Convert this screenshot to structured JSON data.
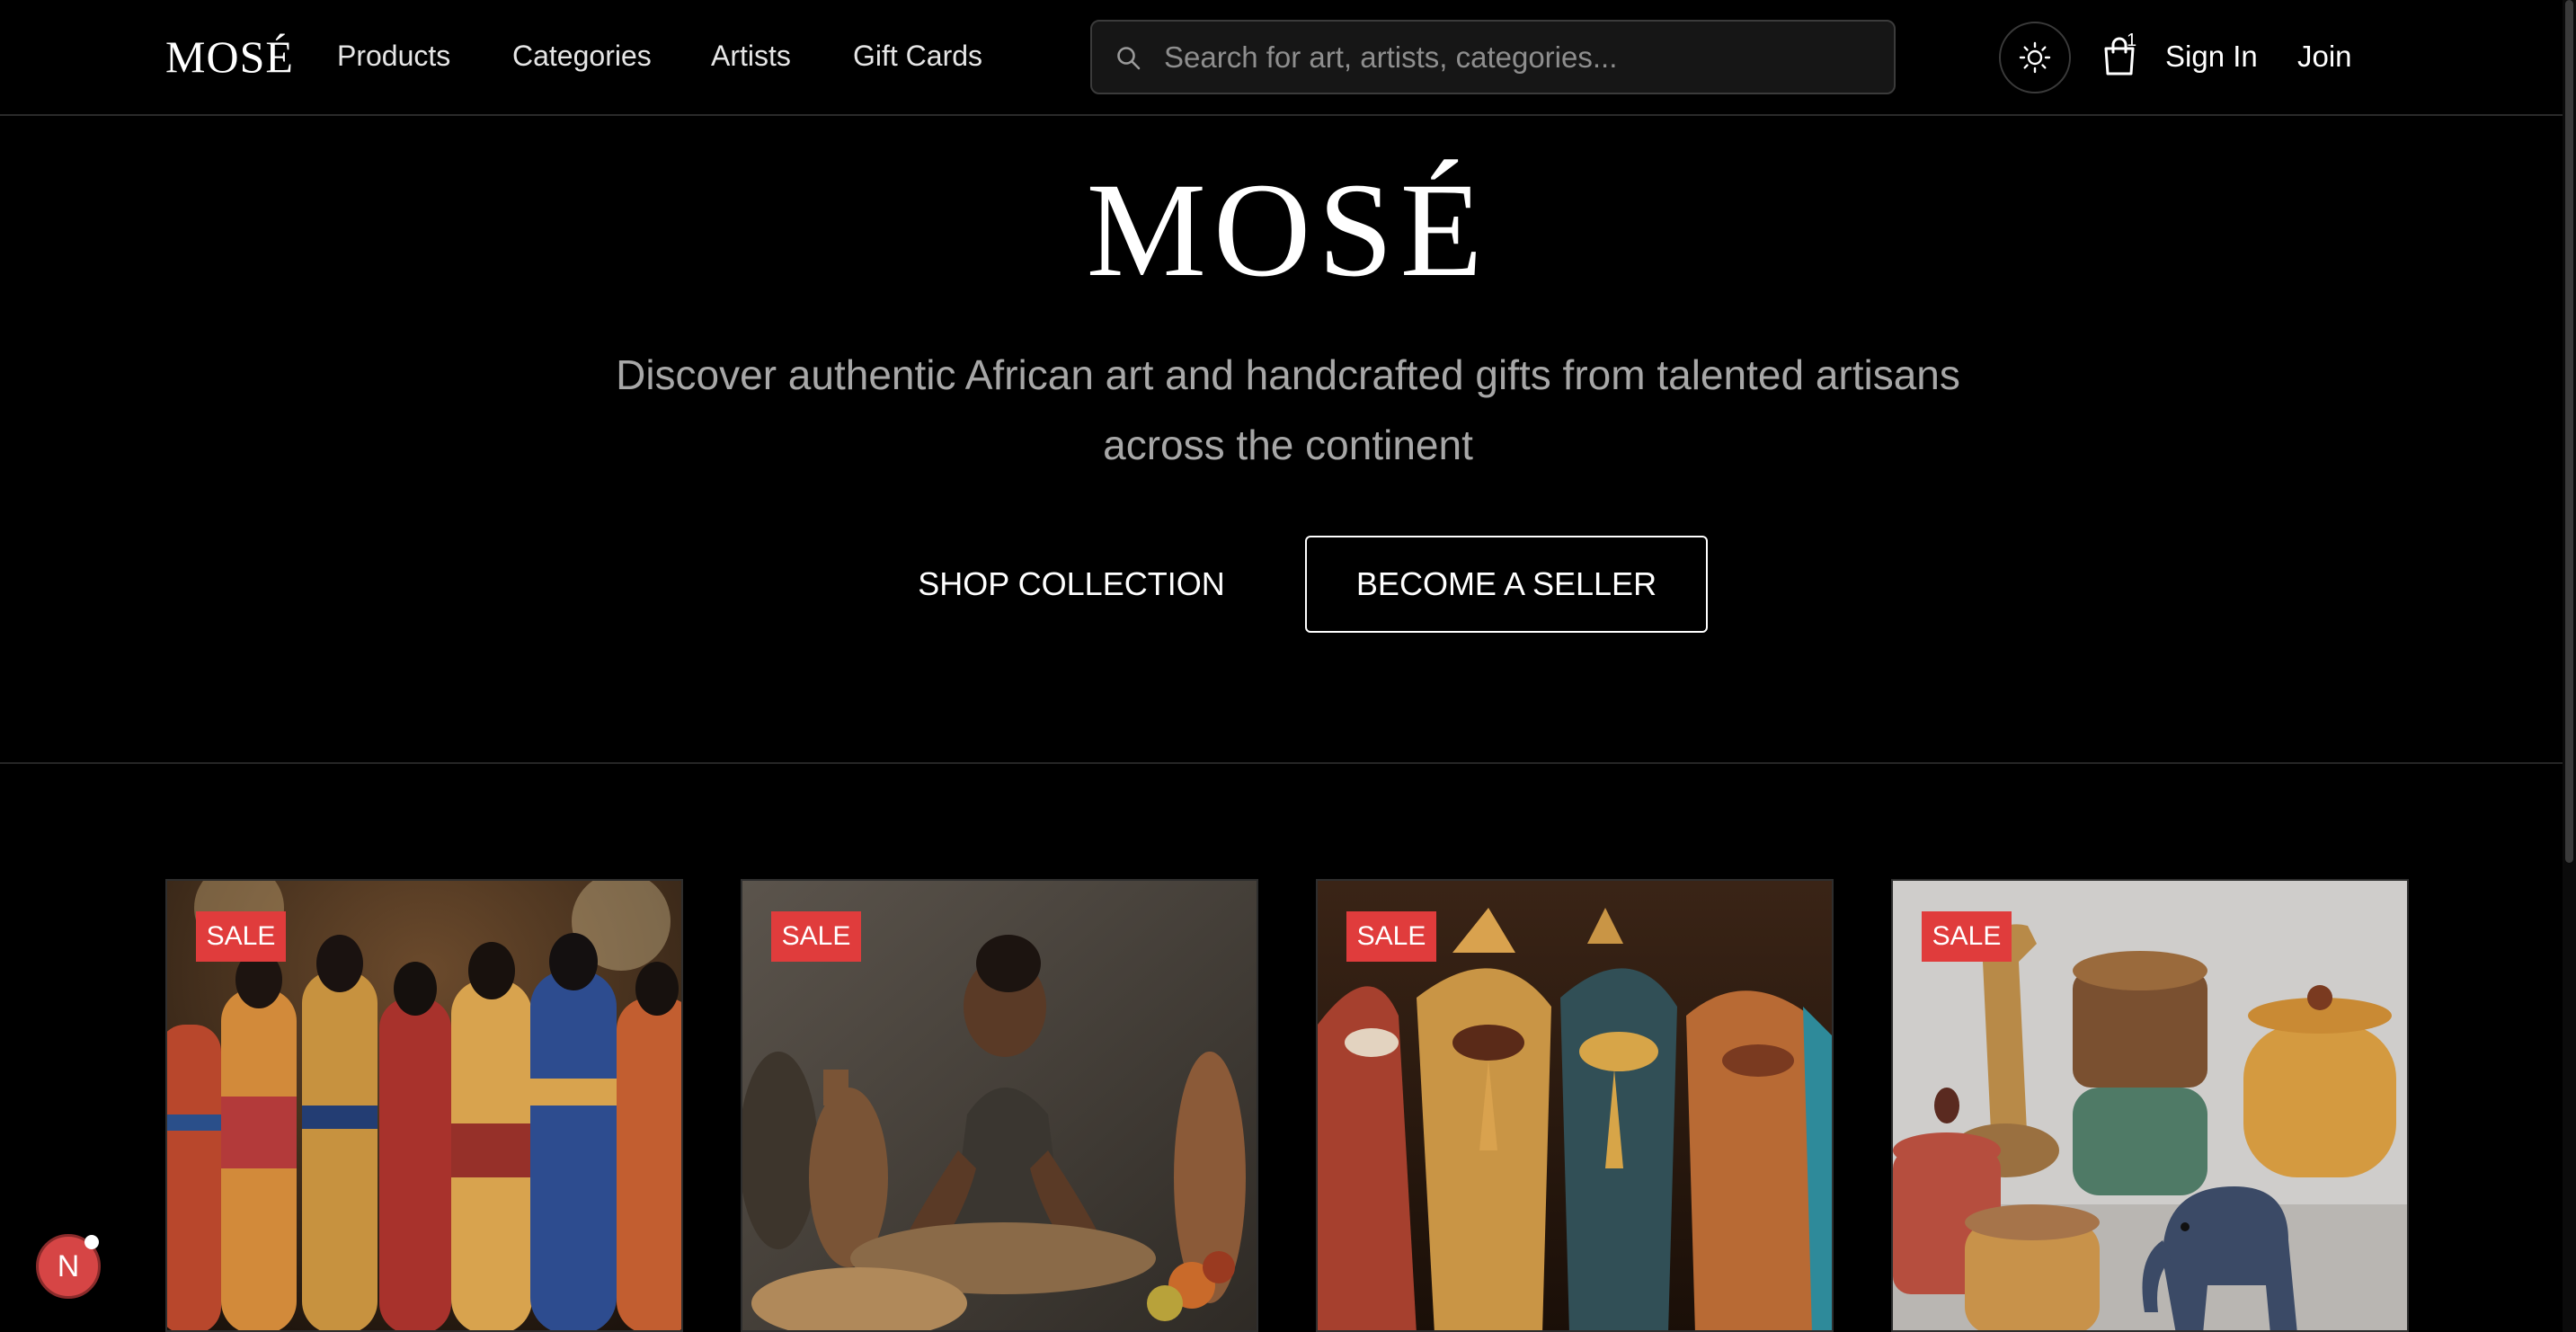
{
  "nav": {
    "logo": "MOSÉ",
    "links": [
      "Products",
      "Categories",
      "Artists",
      "Gift Cards"
    ],
    "search_placeholder": "Search for art, artists, categories...",
    "theme_icon": "sun-icon",
    "cart_icon": "shopping-bag-icon",
    "cart_count": "1",
    "sign_in": "Sign In",
    "join": "Join"
  },
  "hero": {
    "title": "MOSÉ",
    "subtitle": "Discover authentic African art and handcrafted gifts from talented artisans across the continent",
    "primary_cta": "SHOP COLLECTION",
    "secondary_cta": "BECOME A SELLER"
  },
  "products": [
    {
      "badge": "SALE",
      "image": "carved-figurines"
    },
    {
      "badge": "SALE",
      "image": "artisan-at-work"
    },
    {
      "badge": "SALE",
      "image": "bird-sculptures"
    },
    {
      "badge": "SALE",
      "image": "decorative-jars-and-animals"
    }
  ],
  "fab": {
    "initial": "N"
  },
  "colors": {
    "background": "#000000",
    "sale": "#e03c3c",
    "text_muted": "#a7a7a7"
  }
}
